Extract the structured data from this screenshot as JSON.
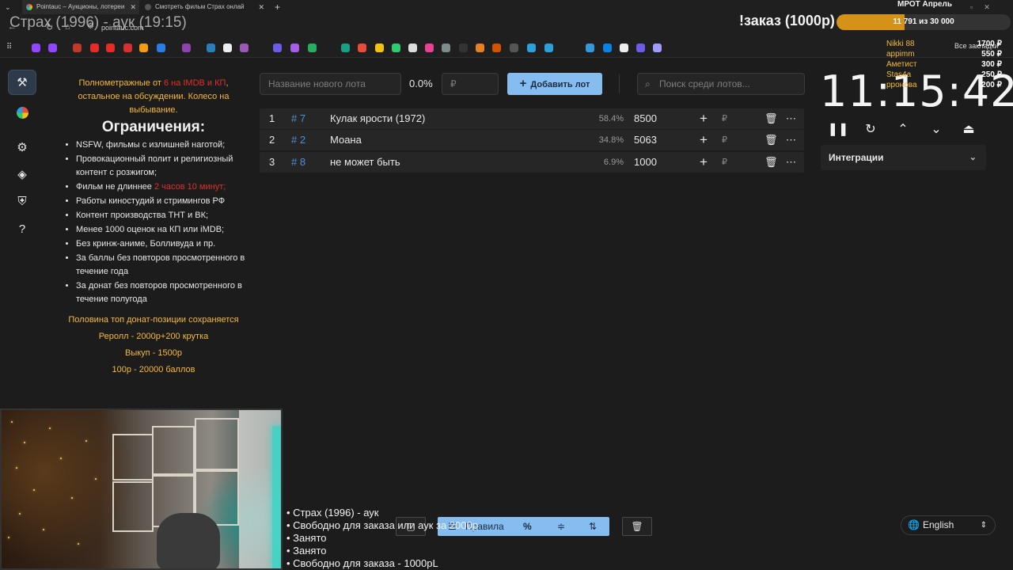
{
  "browser": {
    "tabs": [
      {
        "title": "Pointauc – Аукционы, лотереи"
      },
      {
        "title": "Смотреть фильм Страх онлай"
      }
    ],
    "new_tab": "+",
    "url": "pointauc.com",
    "all_bookmarks": "Все закладки"
  },
  "stream": {
    "title": "Страх (1996) - аук (19:15)",
    "order_title": "!заказ (1000р)",
    "goal": {
      "current": "11 791",
      "text": "из 30 000",
      "fraction": 0.393
    },
    "mrot": "МРОТ Апрель",
    "donors": [
      {
        "name": "Nikki 88",
        "amount": "1700 ₽"
      },
      {
        "name": "appimm",
        "amount": "550 ₽"
      },
      {
        "name": "Аметист",
        "amount": "300 ₽"
      },
      {
        "name": "Stas4a",
        "amount": "250 ₽"
      },
      {
        "name": "рронова",
        "amount": "200 ₽"
      }
    ],
    "overlay_lines": [
      "• Страх (1996) - аук",
      "• Свободно для заказа или аук за 2000р",
      "• Занято",
      "• Занято",
      "• Свободно для заказа - 1000рL"
    ]
  },
  "rules": {
    "intro_1": "Полнометражные от ",
    "intro_red": "6 на IMDB и КП",
    "intro_2": ",",
    "intro_3": "остальное на обсуждении. Колесо на выбывание.",
    "heading": "Ограничения:",
    "items": [
      "NSFW, фильмы с излишней наготой;",
      "Провокационный полит и религиозный контент с розжигом;",
      "Фильм не длиннее ",
      "Работы киностудий и стримингов РФ",
      "Контент производства ТНТ и ВК;",
      "Менее 1000 оценок на КП или iMDB;",
      "Без кринж-аниме, Болливуда и пр.",
      "За баллы без повторов просмотренного в течение года",
      "За донат без повторов просмотренного в течение полугода"
    ],
    "item3_red": "2 часов 10 минут;",
    "footer": [
      "Половина топ донат-позиции сохраняется",
      "Реролл - 2000р+200 крутка",
      "Выкуп - 1500р",
      "100р - 20000 баллов"
    ]
  },
  "controls": {
    "new_lot_placeholder": "Название нового лота",
    "percent": "0.0%",
    "currency_placeholder": "₽",
    "add_button": "Добавить лот",
    "search_placeholder": "Поиск среди лотов..."
  },
  "lots": [
    {
      "pos": "1",
      "id": "# 7",
      "name": "Кулак ярости (1972)",
      "pct": "58.4%",
      "amount": "8500"
    },
    {
      "pos": "2",
      "id": "# 2",
      "name": "Моана",
      "pct": "34.8%",
      "amount": "5063"
    },
    {
      "pos": "3",
      "id": "# 8",
      "name": "не может быть",
      "pct": "6.9%",
      "amount": "1000"
    }
  ],
  "lot_currency": "₽",
  "timer": {
    "value": "11:15:42"
  },
  "integrations_label": "Интеграции",
  "bottom": {
    "rules_button": "Правила",
    "percent_button": "%",
    "language": "English"
  },
  "colors": {
    "accent": "#86bdf0",
    "orange": "#f5b93a",
    "red": "#e0302a",
    "link": "#4f8fd6"
  }
}
